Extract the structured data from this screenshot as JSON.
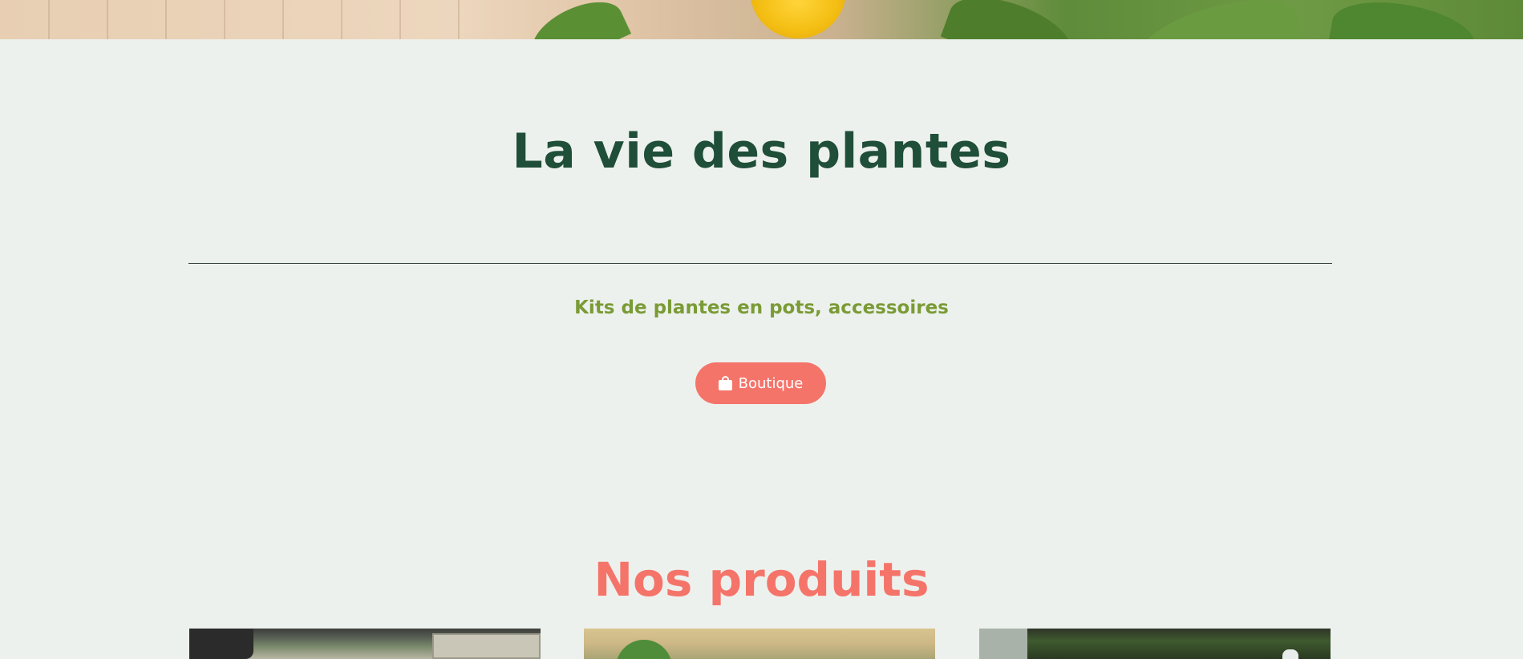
{
  "hero": {
    "title": "La vie des plantes",
    "subtitle": "Kits de plantes en pots, accessoires",
    "shop_button_label": "Boutique",
    "shop_button_icon": "shopping-bag-icon"
  },
  "products": {
    "section_title": "Nos produits"
  },
  "colors": {
    "background": "#edf1ed",
    "title": "#1f4e39",
    "subtitle": "#7a9b36",
    "accent": "#f5746a"
  }
}
